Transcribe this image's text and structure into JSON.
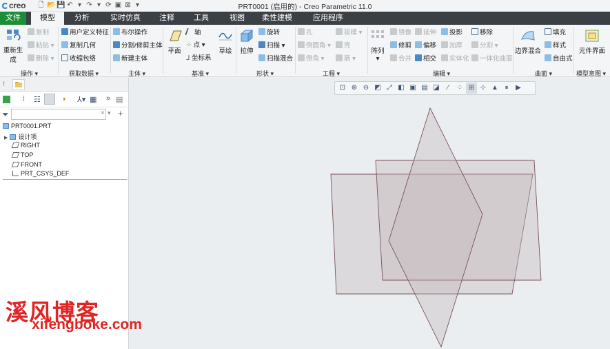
{
  "app": {
    "logo_text": "creo",
    "window_title": "PRT0001 (启用的) - Creo Parametric 11.0"
  },
  "menu": {
    "items": [
      "文件",
      "模型",
      "分析",
      "实时仿真",
      "注释",
      "工具",
      "视图",
      "柔性建模",
      "应用程序"
    ],
    "active": "模型"
  },
  "ribbon": {
    "regenerate": "重新生成",
    "copy": "复制",
    "paste": "粘贴",
    "delete": "删除",
    "user_feature": "用户定义特征",
    "copy_geom": "复制几何",
    "shrinkwrap": "收缩包络",
    "boolean": "布尔操作",
    "split_body": "分割/修剪主体",
    "new_body": "新建主体",
    "plane": "平面",
    "axis": "轴",
    "point": "点",
    "csys": "坐标系",
    "sketch": "草绘",
    "extrude": "拉伸",
    "revolve": "旋转",
    "sweep": "扫描",
    "swept_blend": "扫描混合",
    "hole": "孔",
    "round": "倒圆角",
    "chamfer": "倒角",
    "draft": "拔模",
    "shell": "壳",
    "rib": "筋",
    "pattern": "阵列",
    "mirror": "镜像",
    "trim": "修剪",
    "merge": "合并",
    "extend": "延伸",
    "offset": "偏移",
    "intersect": "相交",
    "project": "投影",
    "thicken": "加厚",
    "solidify": "实体化",
    "remove": "移除",
    "split": "分割",
    "unify": "一体化曲面",
    "boundary_blend": "边界混合",
    "fill": "填充",
    "style": "样式",
    "freestyle": "自由式",
    "component_interface": "元件界面",
    "groups": [
      "操作",
      "获取数据",
      "主体",
      "基准",
      "形状",
      "工程",
      "编辑",
      "曲面",
      "模型意图"
    ]
  },
  "model_tree": {
    "filter_placeholder": "",
    "items": [
      "PRT0001.PRT",
      "设计项",
      "RIGHT",
      "TOP",
      "FRONT",
      "PRT_CSYS_DEF"
    ]
  },
  "watermark": {
    "line1": "溪风博客",
    "line2": "xifengboke.com"
  },
  "colors": {
    "file_menu": "#1e8d37",
    "menubar": "#3b4045",
    "plane_fill": "#c3b7ba",
    "plane_edge": "#7a5258",
    "watermark": "#e02424"
  }
}
